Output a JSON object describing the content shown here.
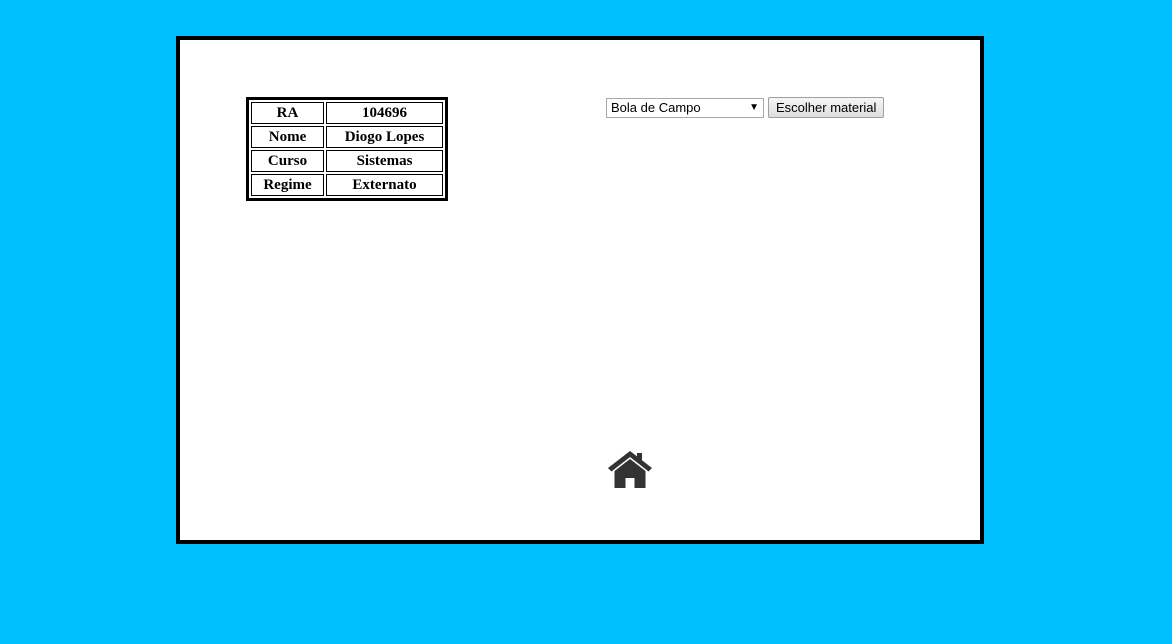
{
  "student": {
    "rows": [
      {
        "label": "RA",
        "value": "104696"
      },
      {
        "label": "Nome",
        "value": "Diogo Lopes"
      },
      {
        "label": "Curso",
        "value": "Sistemas"
      },
      {
        "label": "Regime",
        "value": "Externato"
      }
    ]
  },
  "material": {
    "selected": "Bola de Campo",
    "button_label": "Escolher material"
  },
  "icons": {
    "home": "home-icon",
    "dropdown": "triangle-down-icon"
  },
  "colors": {
    "background": "#00bfff",
    "frame_border": "#000000",
    "icon": "#333333"
  }
}
